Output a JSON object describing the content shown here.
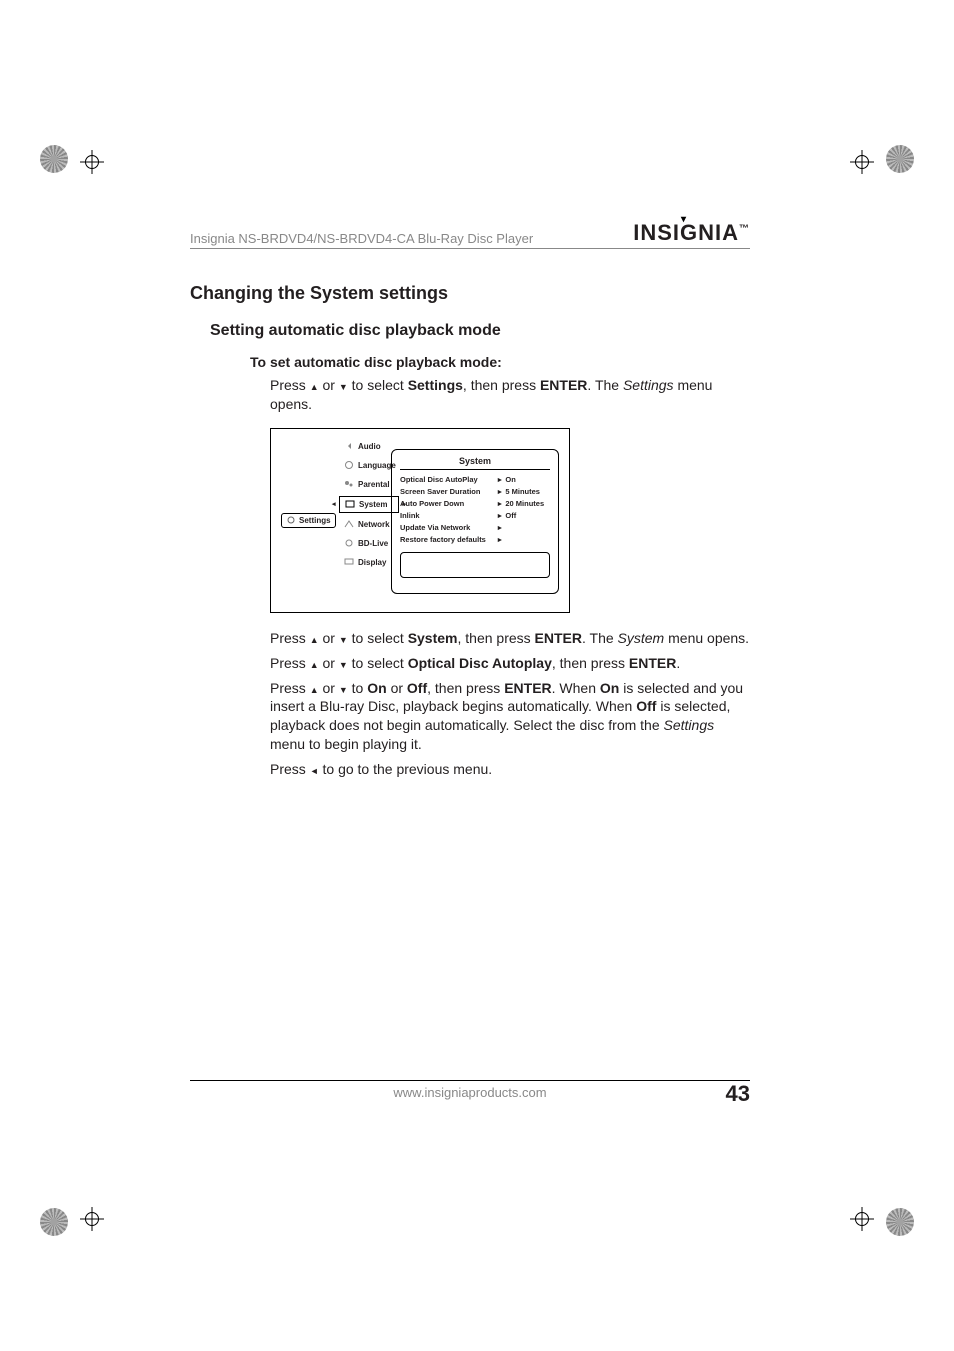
{
  "header": {
    "doc_title": "Insignia NS-BRDVD4/NS-BRDVD4-CA Blu-Ray Disc Player",
    "brand": "INSIGNIA",
    "brand_tm": "™"
  },
  "headings": {
    "h2": "Changing the System settings",
    "h3": "Setting automatic disc playback mode",
    "h4": "To set automatic disc playback mode:"
  },
  "steps": {
    "s1_a": "Press ",
    "s1_b": " or ",
    "s1_c": " to select ",
    "s1_settings": "Settings",
    "s1_d": ", then press ",
    "s1_enter": "ENTER",
    "s1_e": ". The ",
    "s1_settings_ital": "Settings",
    "s1_f": " menu opens.",
    "s2_a": "Press ",
    "s2_b": " or ",
    "s2_c": " to select ",
    "s2_system": "System",
    "s2_d": ", then press ",
    "s2_enter": "ENTER",
    "s2_e": ". The ",
    "s2_system_ital": "System",
    "s2_f": " menu opens.",
    "s3_a": "Press ",
    "s3_b": " or ",
    "s3_c": " to select ",
    "s3_target": "Optical Disc Autoplay",
    "s3_d": ", then press ",
    "s3_enter": "ENTER",
    "s3_e": ".",
    "s4_a": "Press ",
    "s4_b": " or ",
    "s4_c": " to ",
    "s4_on": "On",
    "s4_d": " or ",
    "s4_off": "Off",
    "s4_e": ", then press ",
    "s4_enter": "ENTER",
    "s4_f": ". When ",
    "s4_on2": "On",
    "s4_g": " is selected and you insert a Blu-ray Disc, playback begins automatically. When ",
    "s4_off2": "Off",
    "s4_h": " is selected, playback does not begin automatically. Select the disc from the ",
    "s4_settings_ital": "Settings",
    "s4_i": " menu to begin playing it.",
    "s5_a": "Press ",
    "s5_b": " to go to the previous menu."
  },
  "menu": {
    "settings_label": "Settings",
    "items": [
      "Audio",
      "Language",
      "Parental",
      "System",
      "Network",
      "BD-Live",
      "Display"
    ],
    "panel_title": "System",
    "rows": [
      {
        "label": "Optical Disc AutoPlay",
        "value": "On"
      },
      {
        "label": "Screen Saver Duration",
        "value": "5 Minutes"
      },
      {
        "label": "Auto Power Down",
        "value": "20 Minutes"
      },
      {
        "label": "Inlink",
        "value": "Off"
      },
      {
        "label": "Update Via Network",
        "value": ""
      },
      {
        "label": "Restore factory defaults",
        "value": ""
      }
    ]
  },
  "footer": {
    "url": "www.insigniaproducts.com",
    "page": "43"
  }
}
